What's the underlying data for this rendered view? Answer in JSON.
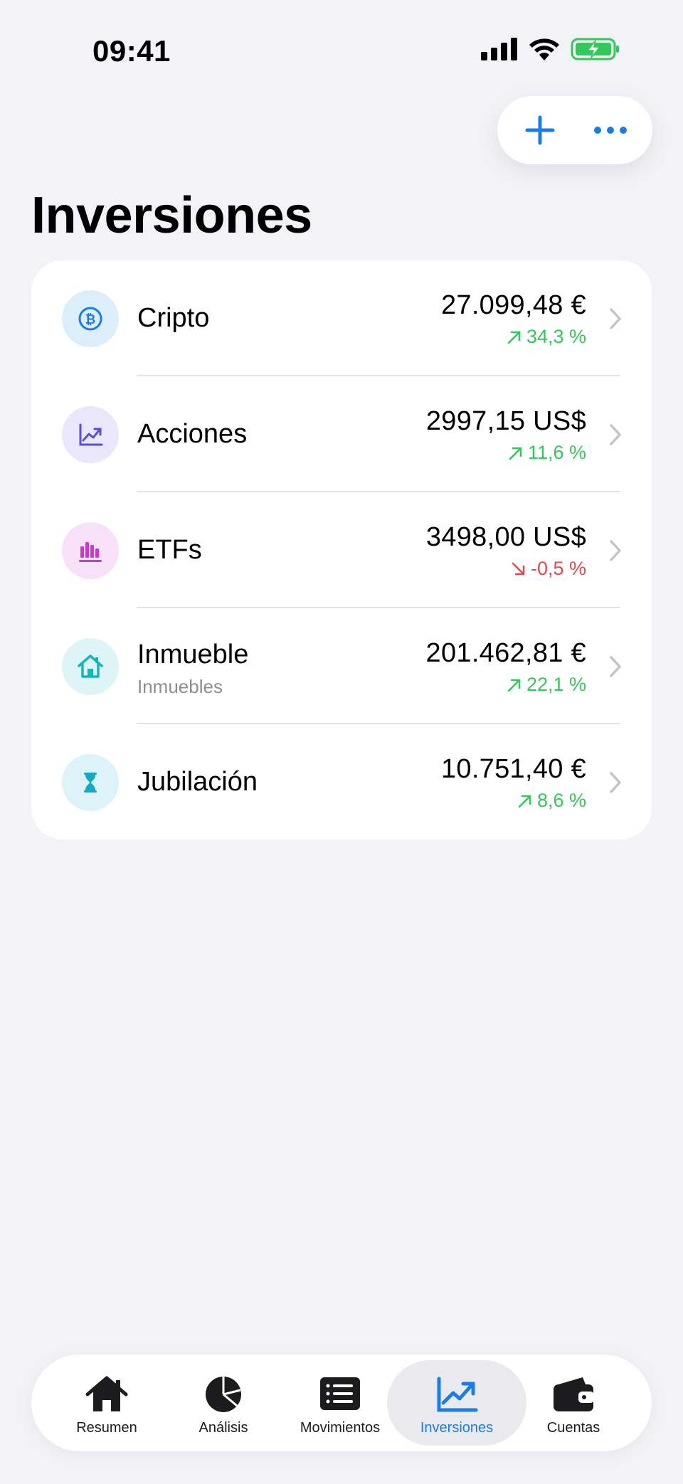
{
  "status_bar": {
    "time": "09:41"
  },
  "header": {
    "title": "Inversiones",
    "actions": [
      "add-icon",
      "more-icon"
    ]
  },
  "colors": {
    "accent": "#1A7CE8",
    "positive": "#34C759",
    "negative": "#E5484D"
  },
  "investments": [
    {
      "name": "Cripto",
      "subtitle": "",
      "value": "27.099,48 €",
      "change": "34,3 %",
      "trend": "up",
      "icon": "bitcoin-icon"
    },
    {
      "name": "Acciones",
      "subtitle": "",
      "value": "2997,15 US$",
      "change": "11,6 %",
      "trend": "up",
      "icon": "stock-chart-icon"
    },
    {
      "name": "ETFs",
      "subtitle": "",
      "value": "3498,00 US$",
      "change": "-0,5 %",
      "trend": "down",
      "icon": "bar-chart-icon"
    },
    {
      "name": "Inmueble",
      "subtitle": "Inmuebles",
      "value": "201.462,81 €",
      "change": "22,1 %",
      "trend": "up",
      "icon": "house-icon"
    },
    {
      "name": "Jubilación",
      "subtitle": "",
      "value": "10.751,40 €",
      "change": "8,6 %",
      "trend": "up",
      "icon": "hourglass-icon"
    }
  ],
  "tabbar": {
    "tabs": [
      {
        "label": "Resumen",
        "icon": "house-icon"
      },
      {
        "label": "Análisis",
        "icon": "pie-chart-icon"
      },
      {
        "label": "Movimientos",
        "icon": "list-icon"
      },
      {
        "label": "Inversiones",
        "icon": "trend-chart-icon",
        "active": true
      },
      {
        "label": "Cuentas",
        "icon": "wallet-icon"
      }
    ]
  }
}
